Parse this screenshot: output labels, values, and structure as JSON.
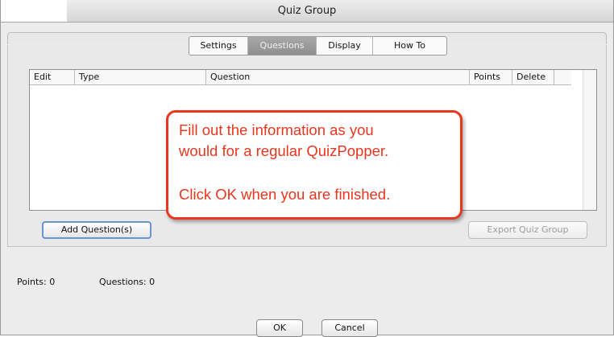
{
  "window": {
    "title": "Quiz Group"
  },
  "tabs": [
    {
      "label": "Settings",
      "active": false
    },
    {
      "label": "Questions",
      "active": true
    },
    {
      "label": "Display",
      "active": false
    },
    {
      "label": "How To",
      "active": false
    }
  ],
  "table": {
    "columns": [
      "Edit",
      "Type",
      "Question",
      "Points",
      "Delete"
    ]
  },
  "callout": {
    "line1": "Fill out the information as you",
    "line2": "would for a regular QuizPopper.",
    "line3": "Click OK when you are finished.",
    "color": "#e8361f"
  },
  "actions": {
    "add_label": "Add Question(s)",
    "export_label": "Export Quiz Group"
  },
  "status": {
    "points": "Points: 0",
    "questions": "Questions: 0"
  },
  "footer": {
    "ok_label": "OK",
    "cancel_label": "Cancel"
  }
}
